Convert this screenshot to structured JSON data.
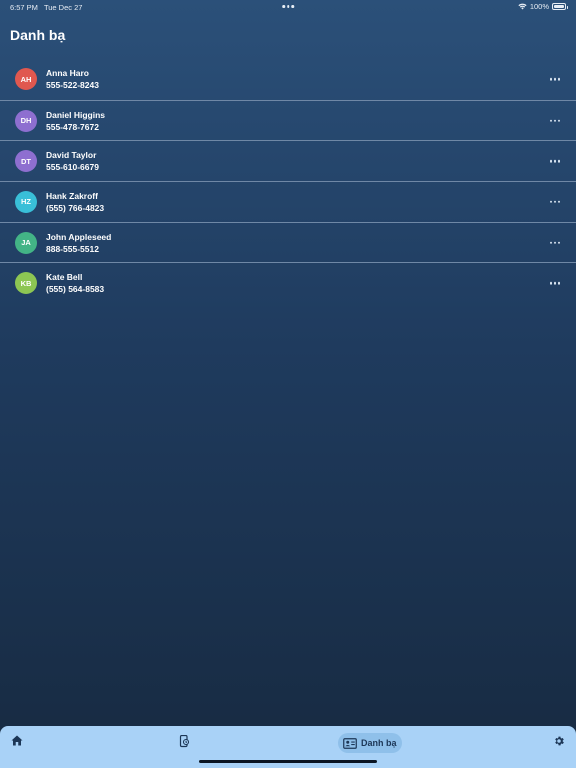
{
  "status_bar": {
    "time": "6:57 PM",
    "date": "Tue Dec 27",
    "battery": "100%",
    "battery_level": 1.0,
    "icons": [
      "wifi-icon",
      "battery-icon"
    ]
  },
  "header": {
    "title": "Danh bạ"
  },
  "contacts": [
    {
      "initials": "AH",
      "name": "Anna Haro",
      "phone": "555-522-8243",
      "color": "#e0584f"
    },
    {
      "initials": "DH",
      "name": "Daniel Higgins",
      "phone": "555-478-7672",
      "color": "#8e6fd0"
    },
    {
      "initials": "DT",
      "name": "David Taylor",
      "phone": "555-610-6679",
      "color": "#8e6fd0"
    },
    {
      "initials": "HZ",
      "name": "Hank Zakroff",
      "phone": "(555) 766-4823",
      "color": "#39bfd8"
    },
    {
      "initials": "JA",
      "name": "John Appleseed",
      "phone": "888-555-5512",
      "color": "#43b486"
    },
    {
      "initials": "KB",
      "name": "Kate Bell",
      "phone": "(555) 564-8583",
      "color": "#8dc653"
    }
  ],
  "tab_bar": {
    "items": [
      {
        "icon": "home-icon",
        "label": ""
      },
      {
        "icon": "device-icon",
        "label": ""
      },
      {
        "icon": "contact-card-icon",
        "label": "Danh bạ",
        "active": true
      },
      {
        "icon": "gear-icon",
        "label": ""
      }
    ]
  },
  "colors": {
    "background_top": "#2b5079",
    "background_bottom": "#172a41",
    "tab_bar": "#a9d2f7",
    "tab_active": "#8fc0ea"
  }
}
